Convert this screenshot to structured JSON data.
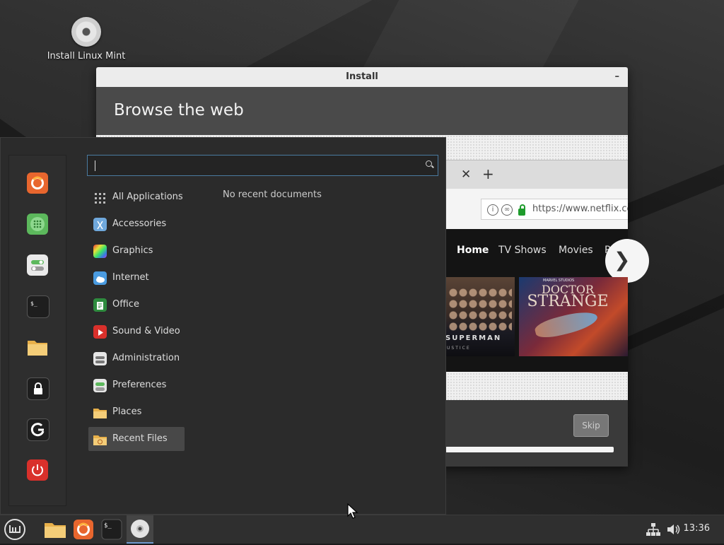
{
  "desktop": {
    "icons": [
      {
        "label": "Install Linux Mint",
        "icon": "disc-icon"
      }
    ]
  },
  "install_window": {
    "title": "Install",
    "minimize_symbol": "–",
    "banner_title": "Browse the web",
    "skip_label": "Skip",
    "slideshow": {
      "browser": {
        "tab_close": "✕",
        "tab_new": "+",
        "url": "https://www.netflix.co",
        "nav": [
          "Home",
          "TV Shows",
          "Movies",
          "R"
        ],
        "next_symbol": "❯",
        "posters": [
          {
            "title": "SUPERMAN",
            "subtitle": "USTICE"
          },
          {
            "studio": "MARVEL STUDIOS",
            "title_line1": "DOCTOR",
            "title_line2": "STRANGE"
          }
        ]
      }
    }
  },
  "menu": {
    "search": {
      "value": "",
      "placeholder": ""
    },
    "favorites": [
      {
        "name": "Firefox",
        "icon": "firefox-icon",
        "color": "#e8662e"
      },
      {
        "name": "Calculator",
        "icon": "calculator-icon",
        "color": "#5cb85c"
      },
      {
        "name": "System Settings",
        "icon": "settings-icon",
        "color": "#eaeaea"
      },
      {
        "name": "Terminal",
        "icon": "terminal-icon",
        "color": "#1e1e1e"
      },
      {
        "name": "Files",
        "icon": "folder-icon",
        "color": "#f0c36a"
      },
      {
        "name": "Lock Screen",
        "icon": "lock-icon",
        "color": "#1e1e1e"
      },
      {
        "name": "Log Out",
        "icon": "logout-icon",
        "color": "#1e1e1e"
      },
      {
        "name": "Quit",
        "icon": "power-icon",
        "color": "#d9302b"
      }
    ],
    "categories": [
      {
        "label": "All Applications",
        "icon": "grid-icon"
      },
      {
        "label": "Accessories",
        "icon": "scissors-icon"
      },
      {
        "label": "Graphics",
        "icon": "palette-icon"
      },
      {
        "label": "Internet",
        "icon": "cloud-icon"
      },
      {
        "label": "Office",
        "icon": "document-icon"
      },
      {
        "label": "Sound & Video",
        "icon": "play-icon"
      },
      {
        "label": "Administration",
        "icon": "admin-icon"
      },
      {
        "label": "Preferences",
        "icon": "toggle-icon"
      },
      {
        "label": "Places",
        "icon": "folder-icon"
      },
      {
        "label": "Recent Files",
        "icon": "recent-folder-icon"
      }
    ],
    "active_category": "Recent Files",
    "empty_message": "No recent documents"
  },
  "taskbar": {
    "items": [
      {
        "name": "Menu",
        "icon": "mint-logo-icon"
      },
      {
        "name": "Files",
        "icon": "folder-icon"
      },
      {
        "name": "Firefox",
        "icon": "firefox-icon"
      },
      {
        "name": "Terminal",
        "icon": "terminal-icon"
      },
      {
        "name": "Install Linux Mint",
        "icon": "disc-icon"
      }
    ],
    "tray": {
      "network": "network-icon",
      "volume": "volume-icon"
    },
    "clock": "13:36"
  },
  "colors": {
    "accent": "#4a7aa0",
    "menu_bg": "#2b2b2b",
    "panel_bg": "#2f2f2f"
  }
}
